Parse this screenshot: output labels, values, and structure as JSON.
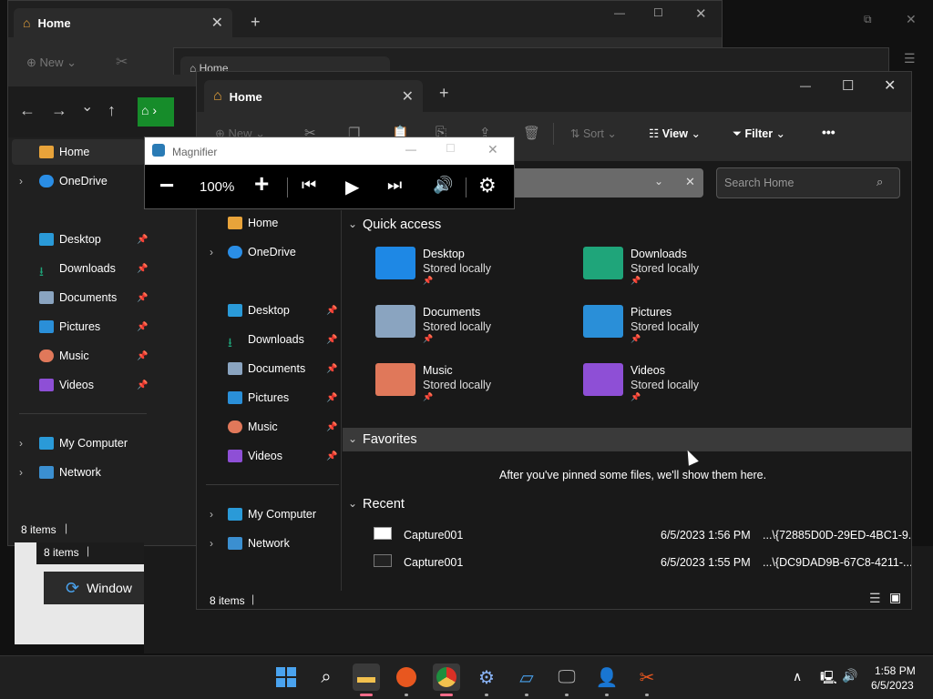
{
  "back_window_2": {
    "tab_title": "Home",
    "close": "✕",
    "new_tab": "+",
    "new_label": "New",
    "nav": {
      "back": "←",
      "forward": "→",
      "down": "⌄",
      "up": "↑"
    },
    "sidebar": [
      {
        "label": "Home"
      },
      {
        "label": "OneDrive"
      },
      {
        "label": "Desktop"
      },
      {
        "label": "Downloads"
      },
      {
        "label": "Documents"
      },
      {
        "label": "Pictures"
      },
      {
        "label": "Music"
      },
      {
        "label": "Videos"
      },
      {
        "label": "My Computer"
      },
      {
        "label": "Network"
      }
    ],
    "status": "8 items"
  },
  "back_window_1": {
    "tab_title": "Home",
    "status": "8 items"
  },
  "update_window": {
    "label": "Window"
  },
  "main_window": {
    "tab_title": "Home",
    "tab_close": "✕",
    "new_tab": "+",
    "controls": {
      "minimize": "—",
      "maximize": "☐",
      "close": "✕"
    },
    "toolbar": {
      "new": "New",
      "sort": "Sort",
      "view": "View",
      "filter": "Filter",
      "more": "•••"
    },
    "search": {
      "placeholder": "Search Home"
    },
    "sidebar": [
      {
        "label": "Home"
      },
      {
        "label": "OneDrive"
      },
      {
        "label": "Desktop"
      },
      {
        "label": "Downloads"
      },
      {
        "label": "Documents"
      },
      {
        "label": "Pictures"
      },
      {
        "label": "Music"
      },
      {
        "label": "Videos"
      },
      {
        "label": "My Computer"
      },
      {
        "label": "Network"
      }
    ],
    "quick_access": {
      "title": "Quick access",
      "items": [
        {
          "name": "Desktop",
          "sub": "Stored locally",
          "color": "#1e88e5"
        },
        {
          "name": "Downloads",
          "sub": "Stored locally",
          "color": "#1fa57a"
        },
        {
          "name": "Documents",
          "sub": "Stored locally",
          "color": "#8aa4c0"
        },
        {
          "name": "Pictures",
          "sub": "Stored locally",
          "color": "#2a8fd8"
        },
        {
          "name": "Music",
          "sub": "Stored locally",
          "color": "#e0785a"
        },
        {
          "name": "Videos",
          "sub": "Stored locally",
          "color": "#8e4fd6"
        }
      ]
    },
    "favorites": {
      "title": "Favorites",
      "empty": "After you've pinned some files, we'll show them here."
    },
    "recent": {
      "title": "Recent",
      "items": [
        {
          "name": "Capture001",
          "date": "6/5/2023 1:56 PM",
          "path": "...\\{72885D0D-29ED-4BC1-9..."
        },
        {
          "name": "Capture001",
          "date": "6/5/2023 1:55 PM",
          "path": "...\\{DC9DAD9B-67C8-4211-..."
        }
      ]
    },
    "status": "8 items"
  },
  "magnifier": {
    "title": "Magnifier",
    "zoom": "100%",
    "minus": "−",
    "plus": "+",
    "close": "✕"
  },
  "taskbar": {
    "time": "1:58 PM",
    "date": "6/5/2023",
    "chevron": "∧"
  },
  "accent": "#0078d4"
}
